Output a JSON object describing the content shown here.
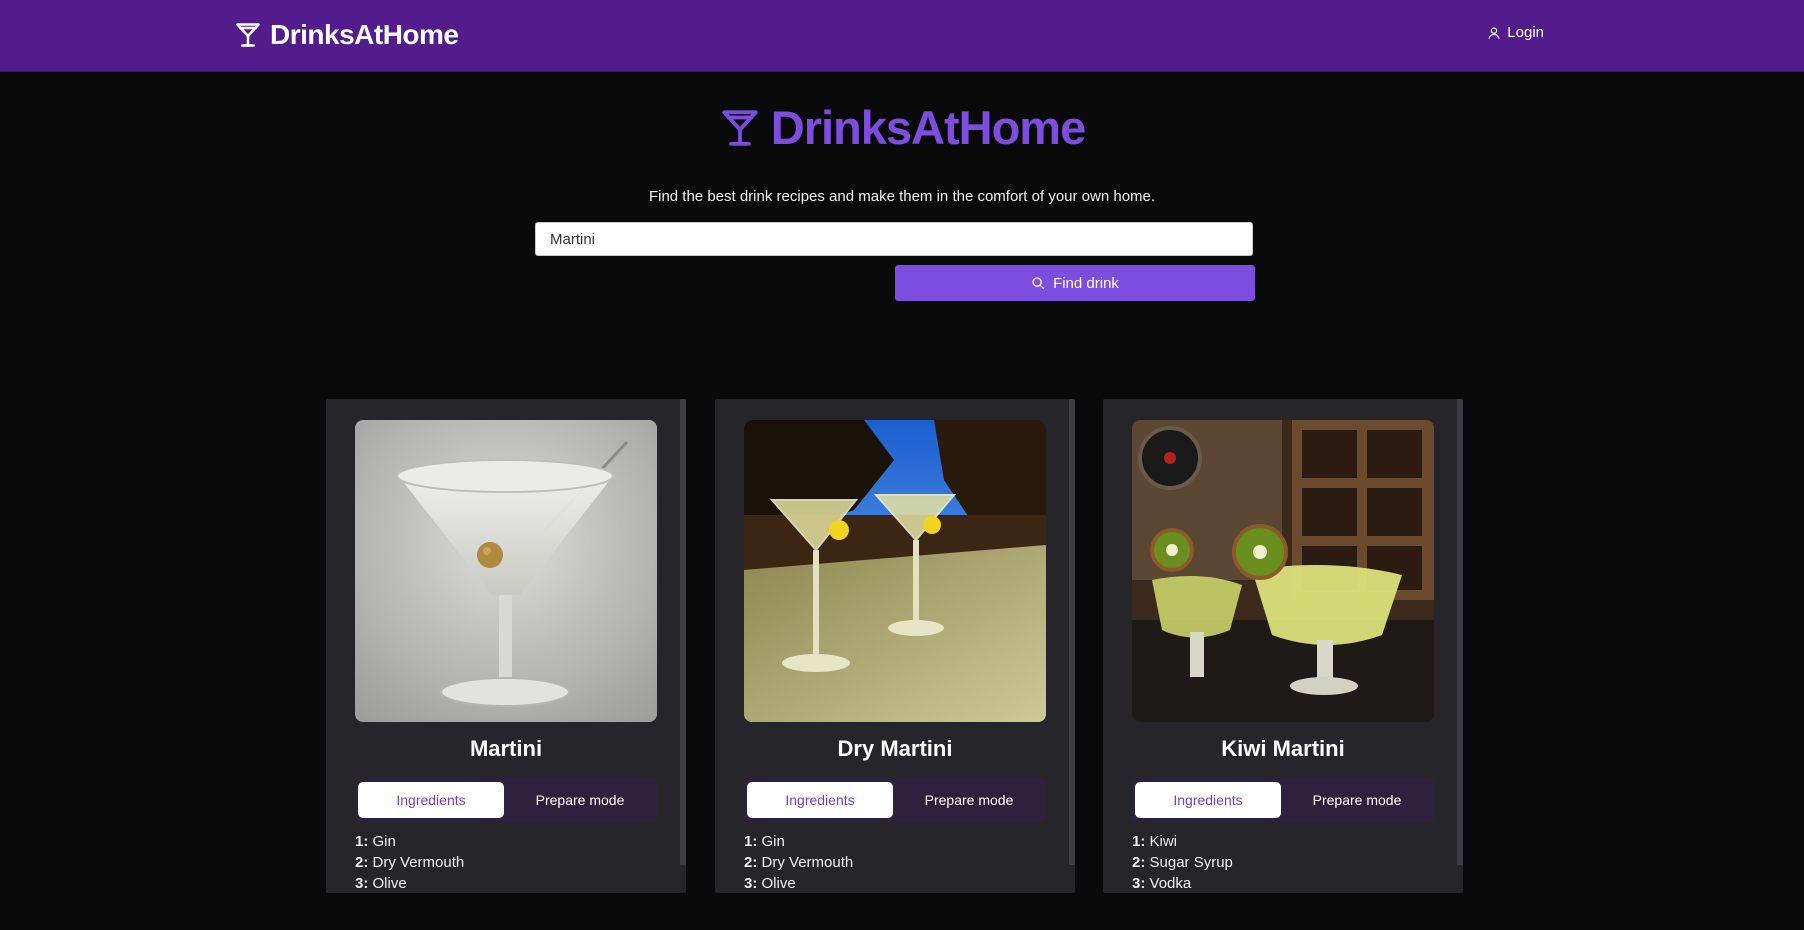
{
  "header": {
    "brand": "DrinksAtHome",
    "login_label": "Login"
  },
  "hero": {
    "title": "DrinksAtHome",
    "tagline": "Find the best drink recipes and make them in the comfort of your own home."
  },
  "search": {
    "value": "Martini",
    "button_label": "Find drink"
  },
  "cards": [
    {
      "name": "Martini",
      "tabs": [
        "Ingredients",
        "Prepare mode"
      ],
      "ingredients": [
        {
          "n": "1:",
          "item": "Gin"
        },
        {
          "n": "2:",
          "item": "Dry Vermouth"
        },
        {
          "n": "3:",
          "item": "Olive"
        }
      ]
    },
    {
      "name": "Dry Martini",
      "tabs": [
        "Ingredients",
        "Prepare mode"
      ],
      "ingredients": [
        {
          "n": "1:",
          "item": "Gin"
        },
        {
          "n": "2:",
          "item": "Dry Vermouth"
        },
        {
          "n": "3:",
          "item": "Olive"
        }
      ]
    },
    {
      "name": "Kiwi Martini",
      "tabs": [
        "Ingredients",
        "Prepare mode"
      ],
      "ingredients": [
        {
          "n": "1:",
          "item": "Kiwi"
        },
        {
          "n": "2:",
          "item": "Sugar Syrup"
        },
        {
          "n": "3:",
          "item": "Vodka"
        }
      ]
    }
  ],
  "icons": {
    "brand": "martini-glass-icon",
    "login": "user-icon",
    "search": "search-icon"
  },
  "colors": {
    "header_bg": "#531c8c",
    "accent": "#7c4ddf",
    "page_bg": "#0a0a0b",
    "card_bg": "#26262a",
    "active_tab_text": "#7b3cc8"
  }
}
